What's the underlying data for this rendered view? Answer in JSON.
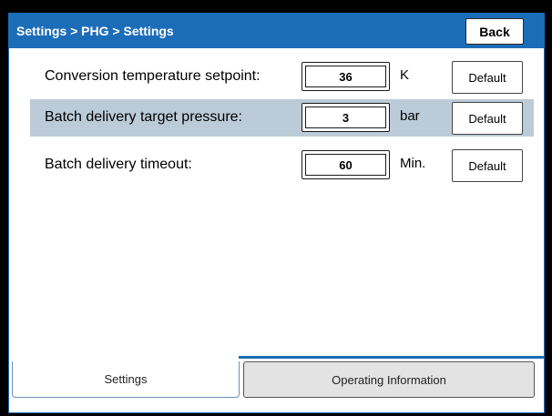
{
  "header": {
    "breadcrumb": "Settings > PHG > Settings",
    "back_label": "Back"
  },
  "settings": [
    {
      "label": "Conversion temperature setpoint:",
      "value": "36",
      "unit": "K",
      "default_label": "Default",
      "highlighted": false
    },
    {
      "label": "Batch delivery target pressure:",
      "value": "3",
      "unit": "bar",
      "default_label": "Default",
      "highlighted": true
    },
    {
      "label": "Batch delivery timeout:",
      "value": "60",
      "unit": "Min.",
      "default_label": "Default",
      "highlighted": false
    }
  ],
  "tabs": {
    "settings_label": "Settings",
    "info_label": "Operating Information"
  },
  "colors": {
    "title_bar": "#1c6db8",
    "row_highlight": "#bccbd8",
    "tab_inactive": "#e3e3e3"
  }
}
